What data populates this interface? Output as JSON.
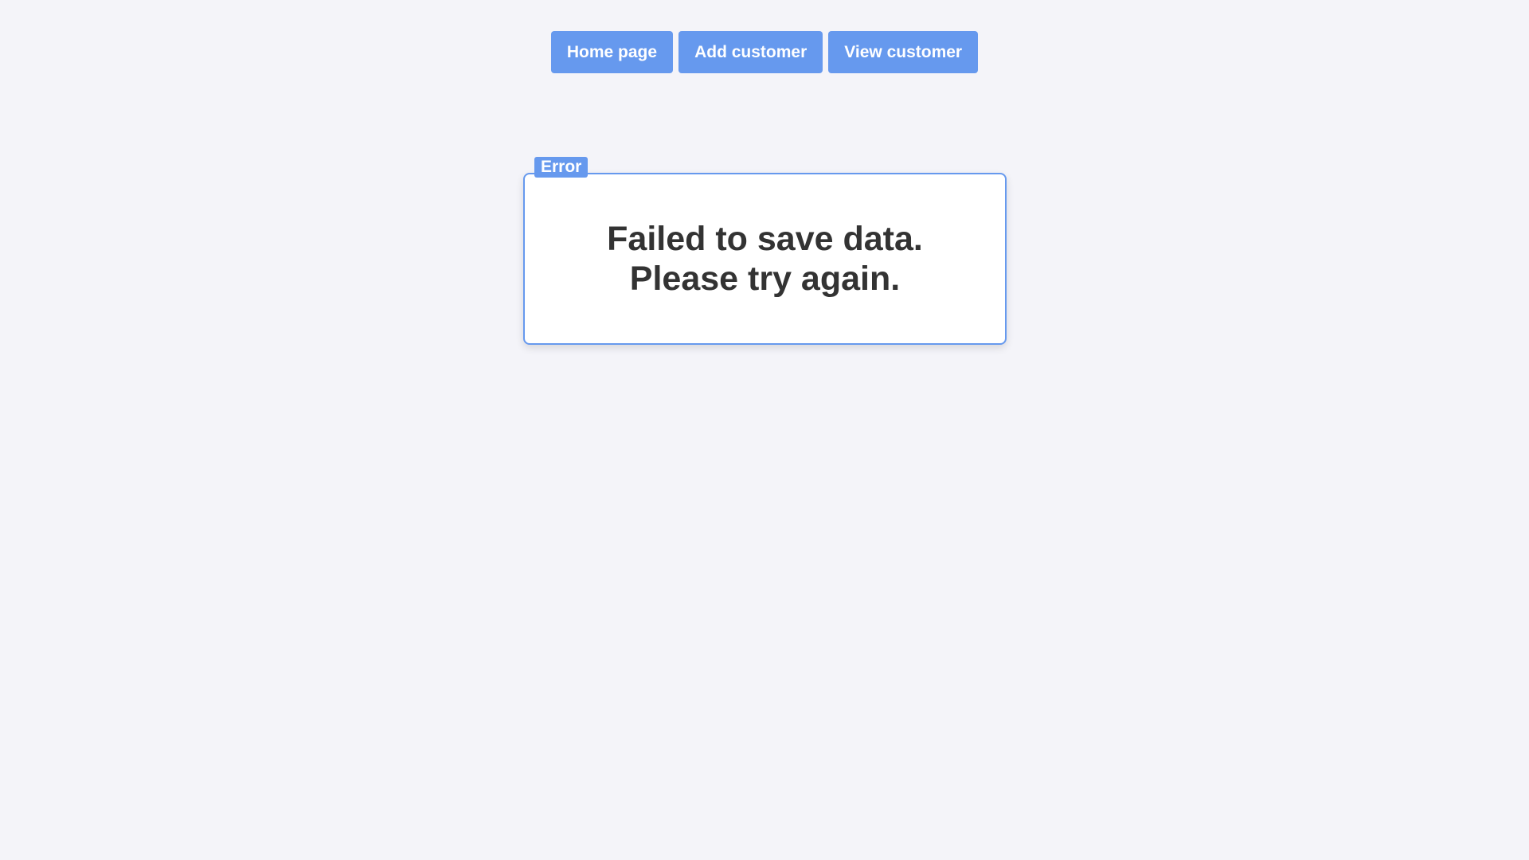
{
  "nav": {
    "items": [
      {
        "label": "Home page"
      },
      {
        "label": "Add customer"
      },
      {
        "label": "View customer"
      }
    ]
  },
  "error": {
    "legend": "Error",
    "message_lines": [
      "Failed to save data.",
      "Please try again."
    ]
  },
  "colors": {
    "accent": "#6699ee",
    "background": "#f4f4f9",
    "text": "#333333"
  }
}
